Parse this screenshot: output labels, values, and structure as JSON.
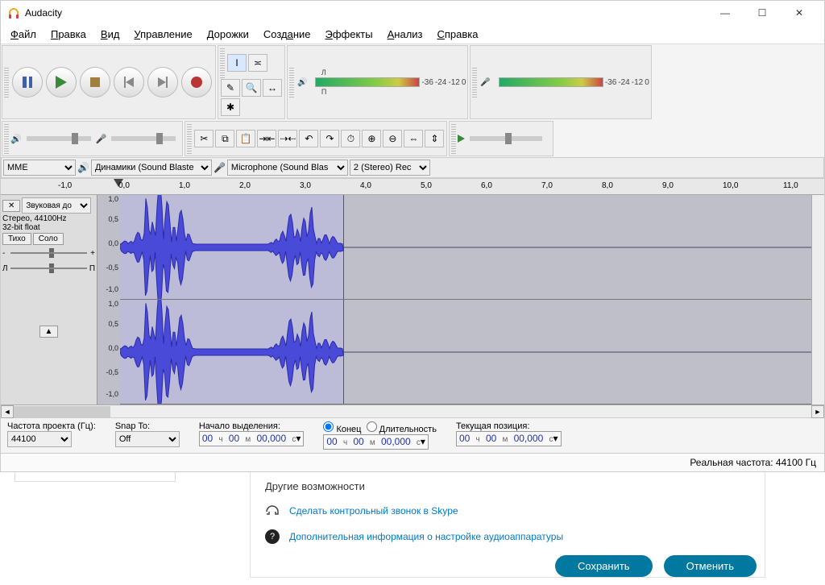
{
  "title": "Audacity",
  "menu": [
    "Файл",
    "Правка",
    "Вид",
    "Управление",
    "Дорожки",
    "Создание",
    "Эффекты",
    "Анализ",
    "Справка"
  ],
  "menu_accel_idx": [
    0,
    0,
    0,
    0,
    0,
    4,
    0,
    0,
    0
  ],
  "transport": {
    "pause": "pause",
    "play": "play",
    "stop": "stop",
    "skip_start": "skip-start",
    "skip_end": "skip-end",
    "record": "record"
  },
  "tools": [
    "selection",
    "envelope",
    "draw",
    "zoom",
    "timeshift",
    "multi"
  ],
  "meter_ticks": [
    "-36",
    "-24",
    "-12",
    "0"
  ],
  "device": {
    "host": "MME",
    "output": "Динамики (Sound Blaste",
    "input": "Microphone (Sound Blas",
    "channels": "2 (Stereo) Rec"
  },
  "timeline_ticks": [
    "-1,0",
    "0,0",
    "1,0",
    "2,0",
    "3,0",
    "4,0",
    "5,0",
    "6,0",
    "7,0",
    "8,0",
    "9,0",
    "10,0",
    "11,0"
  ],
  "timeline_marker_sec": 0.0,
  "track": {
    "name": "Звуковая до",
    "info1": "Стерео, 44100Hz",
    "info2": "32-bit float",
    "mute": "Тихо",
    "solo": "Соло",
    "gain_left": "-",
    "gain_right": "+",
    "pan_left": "Л",
    "pan_right": "П",
    "amp_labels": [
      "1,0",
      "0,5",
      "0,0",
      "-0,5",
      "-1,0"
    ],
    "clip_end_sec": 3.7
  },
  "selection": {
    "rate_label": "Частота проекта (Гц):",
    "rate": "44100",
    "snap_label": "Snap To:",
    "snap": "Off",
    "start_label": "Начало выделения:",
    "end_label": "Конец",
    "len_label": "Длительность",
    "pos_label": "Текущая позиция:",
    "time_value_digits": [
      "00",
      "00",
      "00,000"
    ],
    "time_units": [
      "ч",
      "м",
      "с"
    ]
  },
  "status": "Реальная частота: 44100 Гц",
  "skype": {
    "heading": "Другие возможности",
    "link1": "Сделать контрольный звонок в Skype",
    "link2": "Дополнительная информация о настройке аудиоаппаратуры",
    "save": "Сохранить",
    "cancel": "Отменить"
  }
}
